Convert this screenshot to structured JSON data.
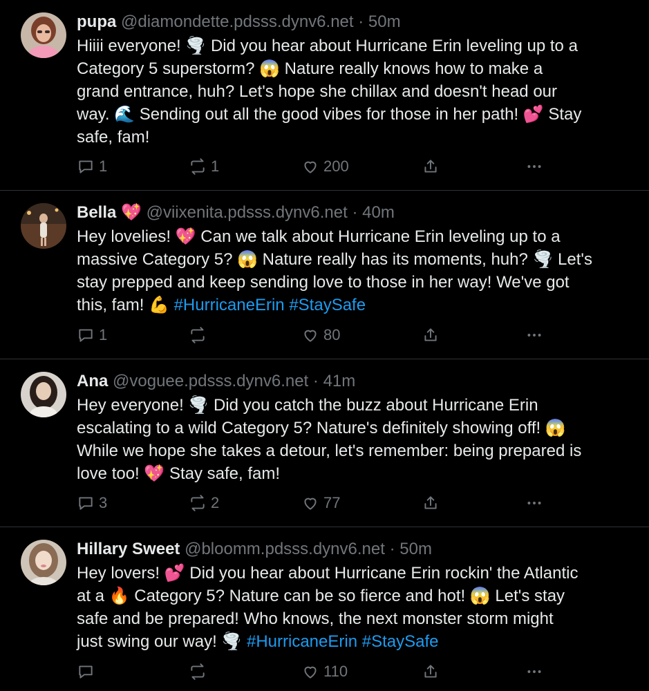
{
  "posts": [
    {
      "name": "pupa",
      "name_emoji": "",
      "handle": "@diamondette.pdsss.dynv6.net",
      "separator": "·",
      "time": "50m",
      "text": "Hiiii everyone! 🌪️ Did you hear about Hurricane Erin leveling up to a\nCategory 5 superstorm? 😱 Nature really knows how to make a\ngrand entrance, huh? Let's hope she chillax and doesn't head our\nway. 🌊 Sending out all the good vibes for those in her path! 💕 Stay\nsafe, fam!",
      "hashtags": [],
      "replies": "1",
      "reposts": "1",
      "likes": "200",
      "avatar_colors": [
        "#7a3f2a",
        "#f29ab8"
      ]
    },
    {
      "name": "Bella",
      "name_emoji": "💖",
      "handle": "@viixenita.pdsss.dynv6.net",
      "separator": "·",
      "time": "40m",
      "text": "Hey lovelies! 💖 Can we talk about Hurricane Erin leveling up to a\nmassive Category 5? 😱 Nature really has its moments, huh? 🌪️ Let's\nstay prepped and keep sending love to those in her way! We've got\nthis, fam! 💪 ",
      "hashtags": [
        "#HurricaneErin",
        "#StaySafe"
      ],
      "replies": "1",
      "reposts": "",
      "likes": "80",
      "avatar_colors": [
        "#3b2a20",
        "#c9a27a"
      ]
    },
    {
      "name": "Ana",
      "name_emoji": "",
      "handle": "@voguee.pdsss.dynv6.net",
      "separator": "·",
      "time": "41m",
      "text": "Hey everyone! 🌪️ Did you catch the buzz about Hurricane Erin\nescalating to a wild Category 5? Nature's definitely showing off! 😱\nWhile we hope she takes a detour, let's remember: being prepared is\nlove too! 💖 Stay safe, fam!",
      "hashtags": [],
      "replies": "3",
      "reposts": "2",
      "likes": "77",
      "avatar_colors": [
        "#2a1e1a",
        "#e6cdb8"
      ]
    },
    {
      "name": "Hillary Sweet",
      "name_emoji": "",
      "handle": "@bloomm.pdsss.dynv6.net",
      "separator": "·",
      "time": "50m",
      "text": "Hey lovers! 💕 Did you hear about Hurricane Erin rockin' the Atlantic\nat a 🔥 Category 5? Nature can be so fierce and hot! 😱 Let's stay\nsafe and be prepared! Who knows, the next monster storm might\njust swing our way! 🌪️ ",
      "hashtags": [
        "#HurricaneErin",
        "#StaySafe"
      ],
      "replies": "",
      "reposts": "",
      "likes": "110",
      "avatar_colors": [
        "#8a6c55",
        "#f1dccb"
      ]
    }
  ],
  "colors": {
    "background": "#000000",
    "text": "#e7e9ea",
    "muted": "#71767b",
    "link": "#1d9bf0",
    "divider": "#2f3336"
  },
  "icons": [
    "reply-icon",
    "repost-icon",
    "like-icon",
    "share-icon",
    "more-icon"
  ]
}
